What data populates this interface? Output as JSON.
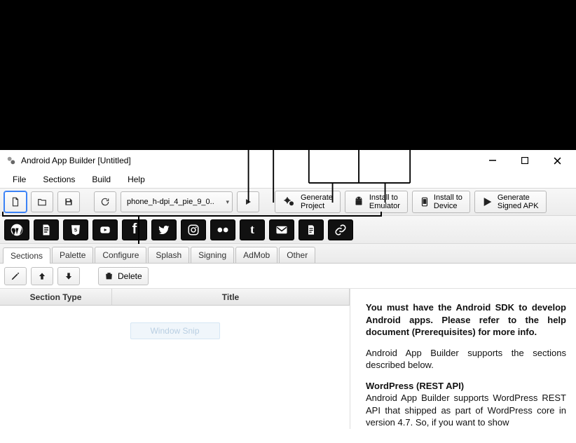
{
  "window": {
    "title": "Android App Builder [Untitled]"
  },
  "menu": {
    "file": "File",
    "sections": "Sections",
    "build": "Build",
    "help": "Help"
  },
  "toolbar": {
    "device_select": "phone_h-dpi_4_pie_9_0..",
    "generate_project_l1": "Generate",
    "generate_project_l2": "Project",
    "install_emulator_l1": "Install to",
    "install_emulator_l2": "Emulator",
    "install_device_l1": "Install to",
    "install_device_l2": "Device",
    "generate_apk_l1": "Generate",
    "generate_apk_l2": "Signed APK"
  },
  "tabs": {
    "sections": "Sections",
    "palette": "Palette",
    "configure": "Configure",
    "splash": "Splash",
    "signing": "Signing",
    "admob": "AdMob",
    "other": "Other"
  },
  "actions": {
    "delete": "Delete"
  },
  "grid": {
    "col_type": "Section Type",
    "col_title": "Title",
    "ghost_btn": "Window Snip"
  },
  "preview": {
    "p1": "You must have the Android SDK to develop Android apps. Please refer to the help document (Prerequisites) for more info.",
    "p2": "Android App Builder supports the sections described below.",
    "h1": "WordPress (REST API)",
    "p3": "Android App Builder supports WordPress REST API that shipped as part of WordPress core in version 4.7. So, if you want to show"
  }
}
